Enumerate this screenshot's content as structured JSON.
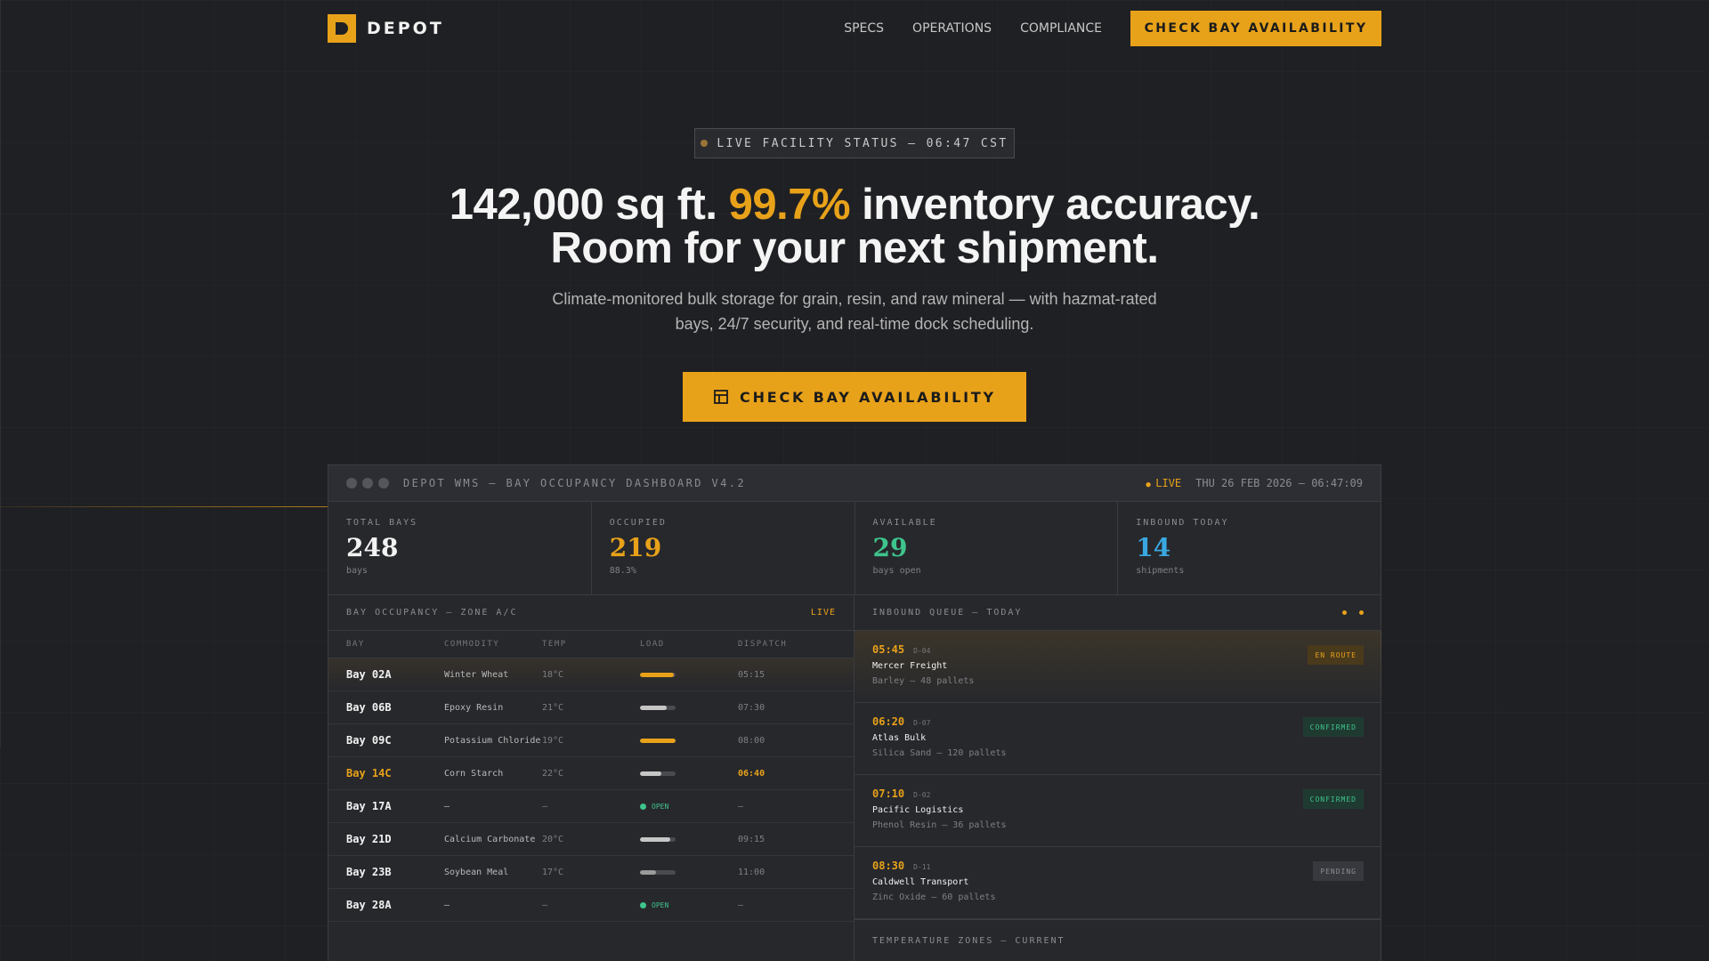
{
  "nav": {
    "brand": "DEPOT",
    "links": [
      "SPECS",
      "OPERATIONS",
      "COMPLIANCE"
    ],
    "cta": "CHECK BAY AVAILABILITY"
  },
  "hero": {
    "status": "LIVE FACILITY STATUS — 06:47 CST",
    "title_part1": "142,000 sq ft. ",
    "title_highlight": "99.7%",
    "title_part2": " inventory accuracy.",
    "title_line2": "Room for your next shipment.",
    "subtitle": "Climate-monitored bulk storage for grain, resin, and raw mineral — with hazmat-rated bays, 24/7 security, and real-time dock scheduling.",
    "cta": "CHECK BAY AVAILABILITY"
  },
  "dashboard": {
    "title": "DEPOT WMS — BAY OCCUPANCY DASHBOARD V4.2",
    "live": "LIVE",
    "timestamp": "THU 26 FEB 2026 — 06:47:09",
    "stats": [
      {
        "label": "TOTAL BAYS",
        "value": "248",
        "sub": "bays",
        "color": "#f2f2f2"
      },
      {
        "label": "OCCUPIED",
        "value": "219",
        "sub": "88.3%",
        "color": "#e8a21a"
      },
      {
        "label": "AVAILABLE",
        "value": "29",
        "sub": "bays open",
        "color": "#3ec48c"
      },
      {
        "label": "INBOUND TODAY",
        "value": "14",
        "sub": "shipments",
        "color": "#3aa8e0"
      }
    ],
    "occupancy": {
      "title": "BAY OCCUPANCY — ZONE A/C",
      "live": "LIVE",
      "columns": [
        "BAY",
        "COMMODITY",
        "TEMP",
        "LOAD",
        "DISPATCH"
      ],
      "rows": [
        {
          "bay": "Bay 02A",
          "commodity": "Winter Wheat",
          "temp": "18°C",
          "load": 0.95,
          "load_color": "#e8a21a",
          "dispatch": "05:15",
          "flag": false
        },
        {
          "bay": "Bay 06B",
          "commodity": "Epoxy Resin",
          "temp": "21°C",
          "load": 0.75,
          "load_color": "#c6c6c6",
          "dispatch": "07:30",
          "flag": false
        },
        {
          "bay": "Bay 09C",
          "commodity": "Potassium Chloride",
          "temp": "19°C",
          "load": 1.0,
          "load_color": "#e8a21a",
          "dispatch": "08:00",
          "flag": false
        },
        {
          "bay": "Bay 14C",
          "commodity": "Corn Starch",
          "temp": "22°C",
          "load": 0.6,
          "load_color": "#c6c6c6",
          "dispatch": "06:40",
          "flag": true
        },
        {
          "bay": "Bay 17A",
          "commodity": "—",
          "temp": "—",
          "open": "OPEN",
          "dispatch": "—",
          "flag": false
        },
        {
          "bay": "Bay 21D",
          "commodity": "Calcium Carbonate",
          "temp": "20°C",
          "load": 0.85,
          "load_color": "#c6c6c6",
          "dispatch": "09:15",
          "flag": false
        },
        {
          "bay": "Bay 23B",
          "commodity": "Soybean Meal",
          "temp": "17°C",
          "load": 0.45,
          "load_color": "#9a9a9a",
          "dispatch": "11:00",
          "flag": false
        },
        {
          "bay": "Bay 28A",
          "commodity": "—",
          "temp": "—",
          "open": "OPEN",
          "dispatch": "—",
          "flag": false
        }
      ]
    },
    "inbound": {
      "title": "INBOUND QUEUE — TODAY",
      "items": [
        {
          "time": "05:45",
          "dock": "D-04",
          "carrier": "Mercer Freight",
          "cargo": "Barley — 48 pallets",
          "status": "EN ROUTE",
          "status_type": "route"
        },
        {
          "time": "06:20",
          "dock": "D-07",
          "carrier": "Atlas Bulk",
          "cargo": "Silica Sand — 120 pallets",
          "status": "CONFIRMED",
          "status_type": "conf"
        },
        {
          "time": "07:10",
          "dock": "D-02",
          "carrier": "Pacific Logistics",
          "cargo": "Phenol Resin — 36 pallets",
          "status": "CONFIRMED",
          "status_type": "conf"
        },
        {
          "time": "08:30",
          "dock": "D-11",
          "carrier": "Caldwell Transport",
          "cargo": "Zinc Oxide — 60 pallets",
          "status": "PENDING",
          "status_type": "pend"
        }
      ]
    },
    "temperature": {
      "title": "TEMPERATURE ZONES — CURRENT",
      "zone_colors": [
        "#2a7fb8",
        "#9a7436",
        "#a05a3c",
        "#9a3c4a"
      ]
    }
  },
  "colors": {
    "accent": "#e8a21a",
    "success": "#3ec48c",
    "info": "#3aa8e0"
  }
}
